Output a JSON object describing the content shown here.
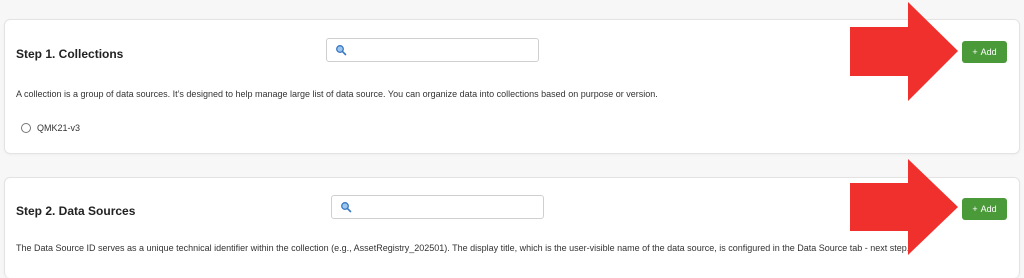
{
  "step1": {
    "title": "Step 1. Collections",
    "search_placeholder": "",
    "add_label": "Add",
    "description": "A collection is a group of data sources. It’s designed to help manage large list of data source. You can organize data into collections based on purpose or version.",
    "collections": [
      "QMK21-v3"
    ]
  },
  "step2": {
    "title": "Step 2. Data Sources",
    "search_placeholder": "",
    "add_label": "Add",
    "description": "The Data Source ID serves as a unique technical identifier within the collection (e.g., AssetRegistry_202501). The display title, which is the user-visible name of the data source, is configured in the Data Source tab - next step."
  },
  "colors": {
    "add_button": "#4a9a3a",
    "annotation_arrow": "#f0302c",
    "search_icon": "#3a78c2"
  },
  "icons": {
    "search": "search-icon",
    "plus": "plus-icon",
    "annotation": "red-arrow-icon"
  }
}
